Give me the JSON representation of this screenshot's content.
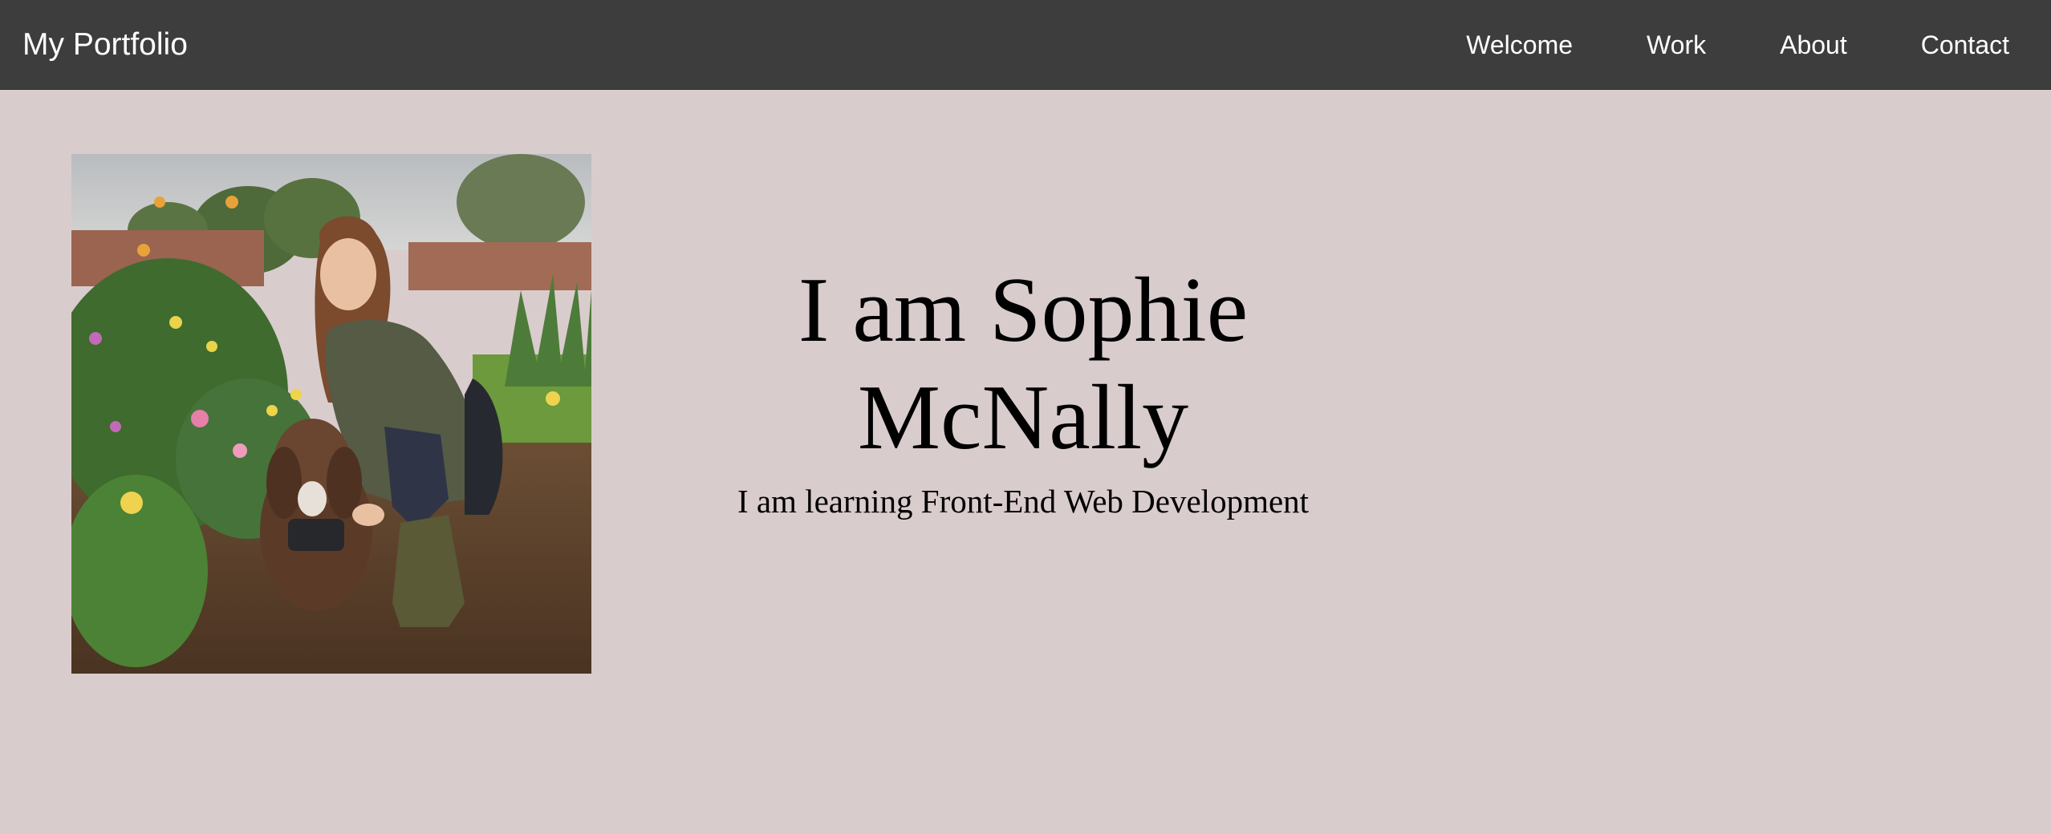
{
  "navbar": {
    "brand": "My Portfolio",
    "links": [
      {
        "label": "Welcome"
      },
      {
        "label": "Work"
      },
      {
        "label": "About"
      },
      {
        "label": "Contact"
      }
    ]
  },
  "hero": {
    "title": "I am Sophie McNally",
    "subtitle": "I am learning Front-End Web Development"
  },
  "colors": {
    "navbar_bg": "#3d3d3d",
    "page_bg": "#d9cccd",
    "nav_text": "#ffffff",
    "body_text": "#000000"
  }
}
